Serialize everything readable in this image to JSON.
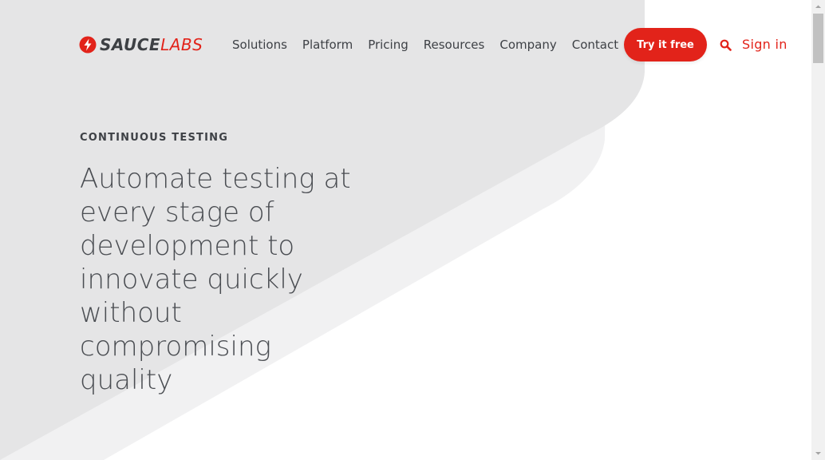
{
  "brand": {
    "name_part1": "SAUCE",
    "name_part2": "LABS",
    "accent_color": "#e2231a",
    "text_color": "#3d4044"
  },
  "nav": {
    "items": [
      {
        "label": "Solutions"
      },
      {
        "label": "Platform"
      },
      {
        "label": "Pricing"
      },
      {
        "label": "Resources"
      },
      {
        "label": "Company"
      },
      {
        "label": "Contact"
      }
    ],
    "cta_label": "Try it free",
    "search_icon": "search-icon",
    "signin_label": "Sign in"
  },
  "hero": {
    "eyebrow": "CONTINUOUS TESTING",
    "headline": "Automate testing at every stage of development to innovate quickly without compromising quality"
  },
  "colors": {
    "bg_shape_dark": "#e5e5e6",
    "bg_shape_light": "#f1f1f2"
  }
}
